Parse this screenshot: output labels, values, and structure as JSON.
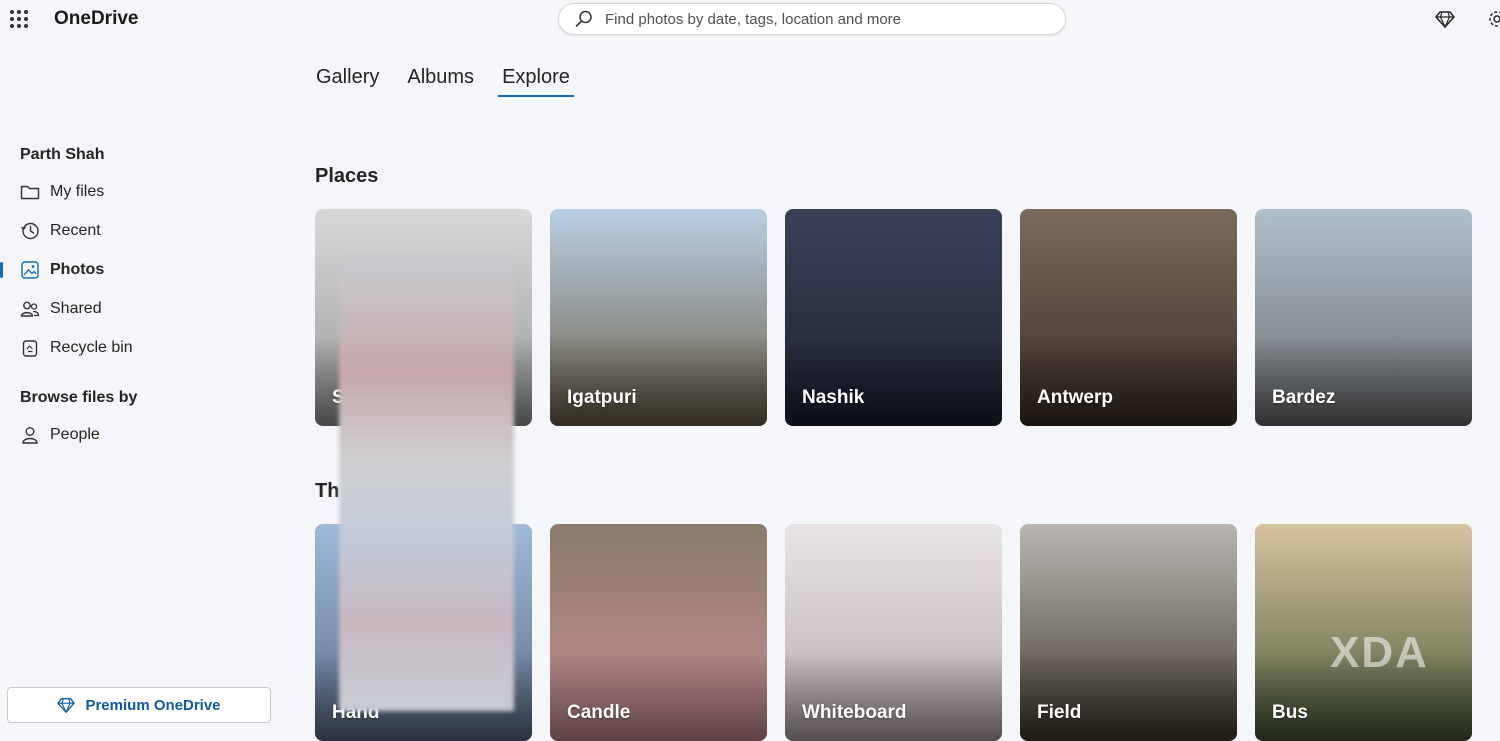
{
  "app": {
    "title": "OneDrive"
  },
  "search": {
    "placeholder": "Find photos by date, tags, location and more"
  },
  "topbar": {
    "icons": [
      "waffle-icon",
      "diamond-icon",
      "gear-icon"
    ]
  },
  "sidebar": {
    "user_name": "Parth Shah",
    "items": [
      {
        "label": "My files",
        "icon": "folder-icon"
      },
      {
        "label": "Recent",
        "icon": "history-icon"
      },
      {
        "label": "Photos",
        "icon": "photo-icon",
        "active": true
      },
      {
        "label": "Shared",
        "icon": "people-icon"
      },
      {
        "label": "Recycle bin",
        "icon": "recycle-bin-icon"
      }
    ],
    "browse_label": "Browse files by",
    "browse_items": [
      {
        "label": "People",
        "icon": "person-icon"
      }
    ],
    "premium_label": "Premium OneDrive"
  },
  "tabs": [
    {
      "label": "Gallery"
    },
    {
      "label": "Albums"
    },
    {
      "label": "Explore",
      "active": true
    }
  ],
  "places": {
    "heading": "Places",
    "cards": [
      {
        "label": "S",
        "colors": [
          "#d7d8d8",
          "#9a9b9c"
        ]
      },
      {
        "label": "Igatpuri",
        "colors": [
          "#b9cfe4",
          "#6d6048"
        ]
      },
      {
        "label": "Nashik",
        "colors": [
          "#3a4258",
          "#1e2233"
        ]
      },
      {
        "label": "Antwerp",
        "colors": [
          "#7a6a5c",
          "#3b2e25"
        ]
      },
      {
        "label": "Bardez",
        "colors": [
          "#aebfcc",
          "#6d6e70"
        ]
      }
    ]
  },
  "things": {
    "heading": "Th",
    "cards": [
      {
        "label": "Hand",
        "colors": [
          "#9fb9d6",
          "#5c6e8a"
        ]
      },
      {
        "label": "Candle",
        "colors": [
          "#8a7b6a",
          "#c98f94"
        ]
      },
      {
        "label": "Whiteboard",
        "colors": [
          "#e8e4e6",
          "#b9a9ad"
        ]
      },
      {
        "label": "Field",
        "colors": [
          "#b9b6b3",
          "#433b2c"
        ]
      },
      {
        "label": "Bus",
        "colors": [
          "#d7c3a2",
          "#4a5a38"
        ]
      }
    ]
  },
  "watermark": "XDA"
}
